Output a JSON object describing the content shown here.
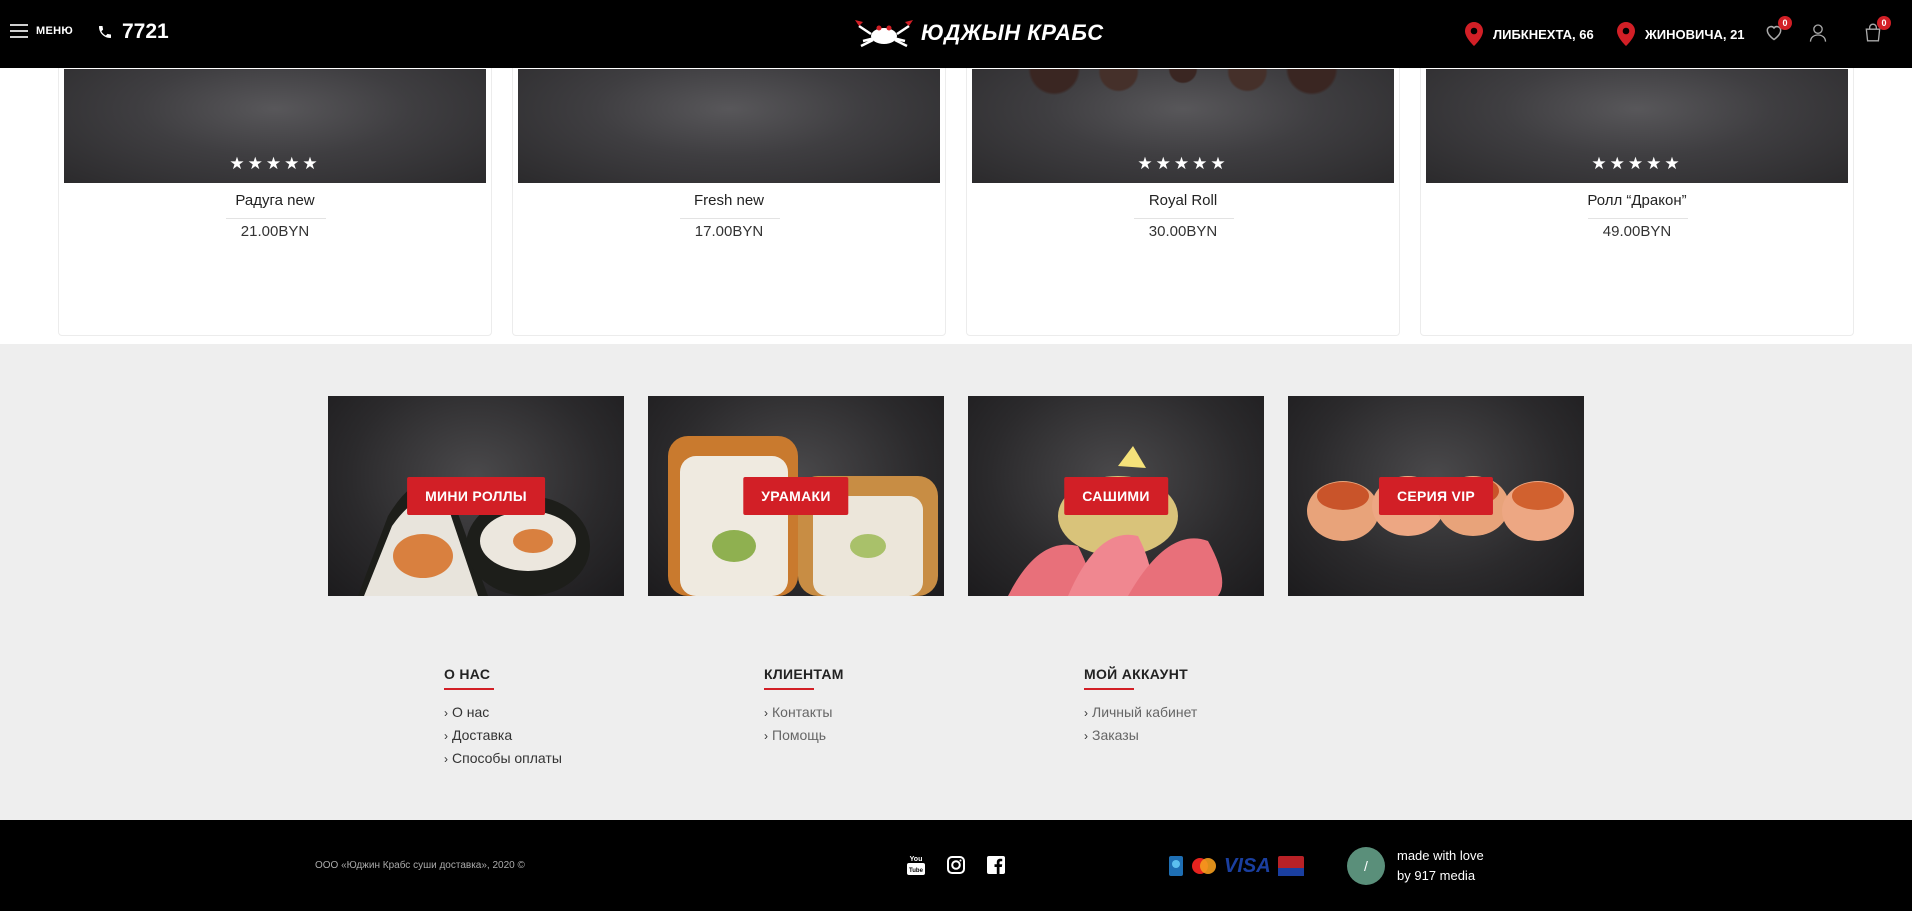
{
  "header": {
    "menu_label": "МЕНЮ",
    "phone": "7721",
    "logo_text": "ЮДЖЫН КРАБС",
    "addresses": [
      "ЛИБКНЕХТА, 66",
      "ЖИНОВИЧА, 21"
    ],
    "wishlist_count": "0",
    "cart_count": "0"
  },
  "products": [
    {
      "name": "Радуга new",
      "price": "21.00BYN",
      "stars": "★★★★★"
    },
    {
      "name": "Fresh new",
      "price": "17.00BYN",
      "stars": ""
    },
    {
      "name": "Royal Roll",
      "price": "30.00BYN",
      "stars": "★★★★★"
    },
    {
      "name": "Ролл “Дракон”",
      "price": "49.00BYN",
      "stars": "★★★★★"
    }
  ],
  "categories": [
    {
      "label": "МИНИ РОЛЛЫ"
    },
    {
      "label": "УРАМАКИ"
    },
    {
      "label": "САШИМИ"
    },
    {
      "label": "СЕРИЯ VIP"
    }
  ],
  "footer_columns": [
    {
      "title": "О НАС",
      "links": [
        "О нас",
        "Доставка",
        "Способы оплаты"
      ]
    },
    {
      "title": "КЛИЕНТАМ",
      "links": [
        "Контакты",
        "Помощь"
      ]
    },
    {
      "title": "МОЙ АККАУНТ",
      "links": [
        "Личный кабинет",
        "Заказы"
      ]
    }
  ],
  "bottom": {
    "copyright": "ООО «Юджин Крабс суши доставка», 2020 ©",
    "payment_visa": "VISA",
    "made_circle": "/",
    "made_line1": "made with love",
    "made_line2": "by 917 media"
  },
  "colors": {
    "accent": "#d21f26",
    "header_bg": "#000000",
    "section_bg": "#eeeeee"
  }
}
